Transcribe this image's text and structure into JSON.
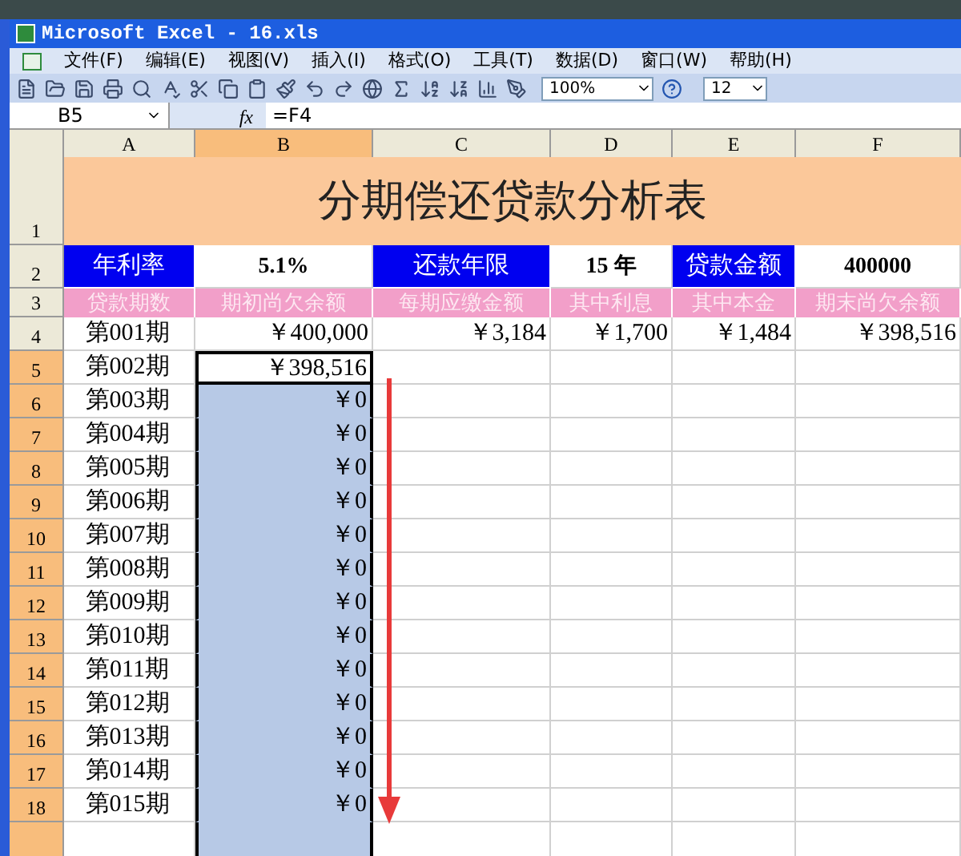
{
  "window": {
    "title": "Microsoft Excel - 16.xls"
  },
  "menu": [
    "文件(F)",
    "编辑(E)",
    "视图(V)",
    "插入(I)",
    "格式(O)",
    "工具(T)",
    "数据(D)",
    "窗口(W)",
    "帮助(H)"
  ],
  "toolbar": {
    "zoom": "100%",
    "font_size": "12"
  },
  "formula_bar": {
    "name_box": "B5",
    "fx": "fx",
    "formula": "=F4"
  },
  "columns": [
    {
      "label": "A",
      "selected": false
    },
    {
      "label": "B",
      "selected": true
    },
    {
      "label": "C",
      "selected": false
    },
    {
      "label": "D",
      "selected": false
    },
    {
      "label": "E",
      "selected": false
    },
    {
      "label": "F",
      "selected": false
    }
  ],
  "sheet": {
    "title_row": "1",
    "title": "分期偿还贷款分析表",
    "params_row": "2",
    "params": [
      {
        "label": "年利率",
        "value": "5.1%"
      },
      {
        "label": "还款年限",
        "value": "15 年"
      },
      {
        "label": "贷款金额",
        "value": "400000"
      }
    ],
    "headers_row": "3",
    "headers": [
      "贷款期数",
      "期初尚欠余额",
      "每期应缴金额",
      "其中利息",
      "其中本金",
      "期末尚欠余额"
    ],
    "rows": [
      {
        "number": "4",
        "selected": false,
        "cells": [
          "第001期",
          "￥400,000",
          "￥3,184",
          "￥1,700",
          "￥1,484",
          "￥398,516"
        ]
      },
      {
        "number": "5",
        "selected": true,
        "cells": [
          "第002期",
          "￥398,516"
        ]
      },
      {
        "number": "6",
        "selected": true,
        "cells": [
          "第003期",
          "￥0"
        ]
      },
      {
        "number": "7",
        "selected": true,
        "cells": [
          "第004期",
          "￥0"
        ]
      },
      {
        "number": "8",
        "selected": true,
        "cells": [
          "第005期",
          "￥0"
        ]
      },
      {
        "number": "9",
        "selected": true,
        "cells": [
          "第006期",
          "￥0"
        ]
      },
      {
        "number": "10",
        "selected": true,
        "cells": [
          "第007期",
          "￥0"
        ]
      },
      {
        "number": "11",
        "selected": true,
        "cells": [
          "第008期",
          "￥0"
        ]
      },
      {
        "number": "12",
        "selected": true,
        "cells": [
          "第009期",
          "￥0"
        ]
      },
      {
        "number": "13",
        "selected": true,
        "cells": [
          "第010期",
          "￥0"
        ]
      },
      {
        "number": "14",
        "selected": true,
        "cells": [
          "第011期",
          "￥0"
        ]
      },
      {
        "number": "15",
        "selected": true,
        "cells": [
          "第012期",
          "￥0"
        ]
      },
      {
        "number": "16",
        "selected": true,
        "cells": [
          "第013期",
          "￥0"
        ]
      },
      {
        "number": "17",
        "selected": true,
        "cells": [
          "第014期",
          "￥0"
        ]
      },
      {
        "number": "18",
        "selected": true,
        "cells": [
          "第015期",
          "￥0"
        ]
      }
    ]
  }
}
